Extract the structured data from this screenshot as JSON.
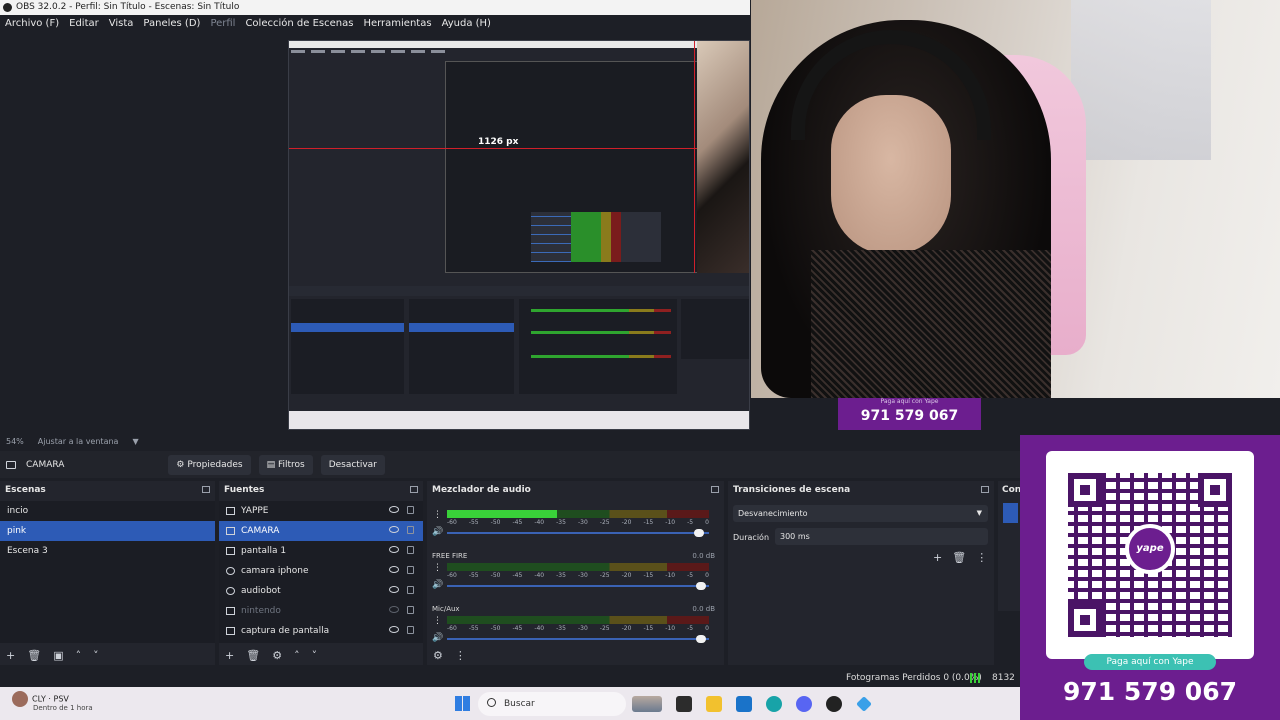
{
  "window": {
    "title": "OBS 32.0.2 - Perfil: Sin Título - Escenas: Sin Título"
  },
  "menu": [
    {
      "label": "Archivo (F)",
      "dim": false
    },
    {
      "label": "Editar",
      "dim": false
    },
    {
      "label": "Vista",
      "dim": false
    },
    {
      "label": "Paneles (D)",
      "dim": false
    },
    {
      "label": "Perfil",
      "dim": true
    },
    {
      "label": "Colección de Escenas",
      "dim": false
    },
    {
      "label": "Herramientas",
      "dim": false
    },
    {
      "label": "Ayuda (H)",
      "dim": false
    }
  ],
  "preview": {
    "nested_width_label": "1126 px"
  },
  "zoom": {
    "percent": "54%",
    "fit_label": "Ajustar a la ventana"
  },
  "source_toolbar": {
    "source_name": "CAMARA",
    "properties_label": "Propiedades",
    "filters_label": "Filtros",
    "deactivate_label": "Desactivar"
  },
  "scenes": {
    "title": "Escenas",
    "items": [
      {
        "label": "incio",
        "selected": false
      },
      {
        "label": "pink",
        "selected": true
      },
      {
        "label": "Escena 3",
        "selected": false
      }
    ]
  },
  "sources": {
    "title": "Fuentes",
    "items": [
      {
        "label": "YAPPE",
        "icon": "image-icon",
        "selected": false,
        "hidden": false
      },
      {
        "label": "CAMARA",
        "icon": "camera-icon",
        "selected": true,
        "hidden": false
      },
      {
        "label": "pantalla 1",
        "icon": "monitor-icon",
        "selected": false,
        "hidden": false
      },
      {
        "label": "camara iphone",
        "icon": "globe-icon",
        "selected": false,
        "hidden": false
      },
      {
        "label": "audiobot",
        "icon": "globe-icon",
        "selected": false,
        "hidden": false
      },
      {
        "label": "nintendo",
        "icon": "camera-icon",
        "selected": false,
        "hidden": true
      },
      {
        "label": "captura de pantalla",
        "icon": "monitor-icon",
        "selected": false,
        "hidden": false
      }
    ]
  },
  "mixer": {
    "title": "Mezclador de audio",
    "ticks": [
      "-60",
      "-55",
      "-50",
      "-45",
      "-40",
      "-35",
      "-30",
      "-25",
      "-20",
      "-15",
      "-10",
      "-5",
      "0"
    ],
    "channels": [
      {
        "name": "",
        "db": "",
        "level": 0.42,
        "volume": 0.96
      },
      {
        "name": "FREE FIRE",
        "db": "0.0 dB",
        "level": 0.0,
        "volume": 0.97
      },
      {
        "name": "Mic/Aux",
        "db": "0.0 dB",
        "level": 0.0,
        "volume": 0.97
      }
    ]
  },
  "transitions": {
    "title": "Transiciones de escena",
    "selected": "Desvanecimiento",
    "duration_label": "Duración",
    "duration_value": "300 ms"
  },
  "controls": {
    "title": "Con"
  },
  "status": {
    "dropped_frames": "Fotogramas Perdidos 0 (0.0%)",
    "bitrate": "8132 k"
  },
  "taskbar": {
    "notif_title": "CLY · PSV",
    "notif_sub": "Dentro de 1 hora",
    "search_label": "Buscar"
  },
  "yape": {
    "banner_small": "Paga aquí con Yape",
    "banner_number": "971 579 067",
    "logo_text": "yape",
    "pay_label": "Paga aquí con Yape",
    "number": "971 579 067"
  },
  "colors": {
    "accent": "#2d5bb6",
    "yape_purple": "#6c1e8f",
    "yape_teal": "#3cc1b3",
    "meter_green": "#39d139"
  }
}
